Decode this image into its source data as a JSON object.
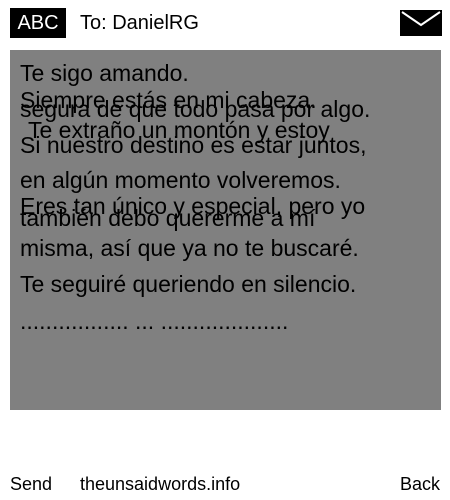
{
  "header": {
    "input_mode": "ABC",
    "recipient": "To: DanielRG",
    "icon": "envelope-icon"
  },
  "message": {
    "lines": [
      "Te sigo amando.",
      "Siempre estás en mi cabeza.",
      "segura de que todo pasa por algo.",
      "Te extraño un montón y estoy",
      "Si nuestro destino es estar juntos,",
      "en algún momento volveremos.",
      "Eres tan único y especial, pero yo",
      "también debo quererme a mí",
      "misma, así que ya no te buscaré.",
      "Te seguiré queriendo en silencio.",
      "................. ... ...................."
    ]
  },
  "softkeys": {
    "left": "Send",
    "center": "theunsaidwords.info",
    "right": "Back"
  },
  "colors": {
    "background": "#ffffff",
    "message_area": "#808080",
    "text": "#000000",
    "mode_badge": "#000000"
  }
}
